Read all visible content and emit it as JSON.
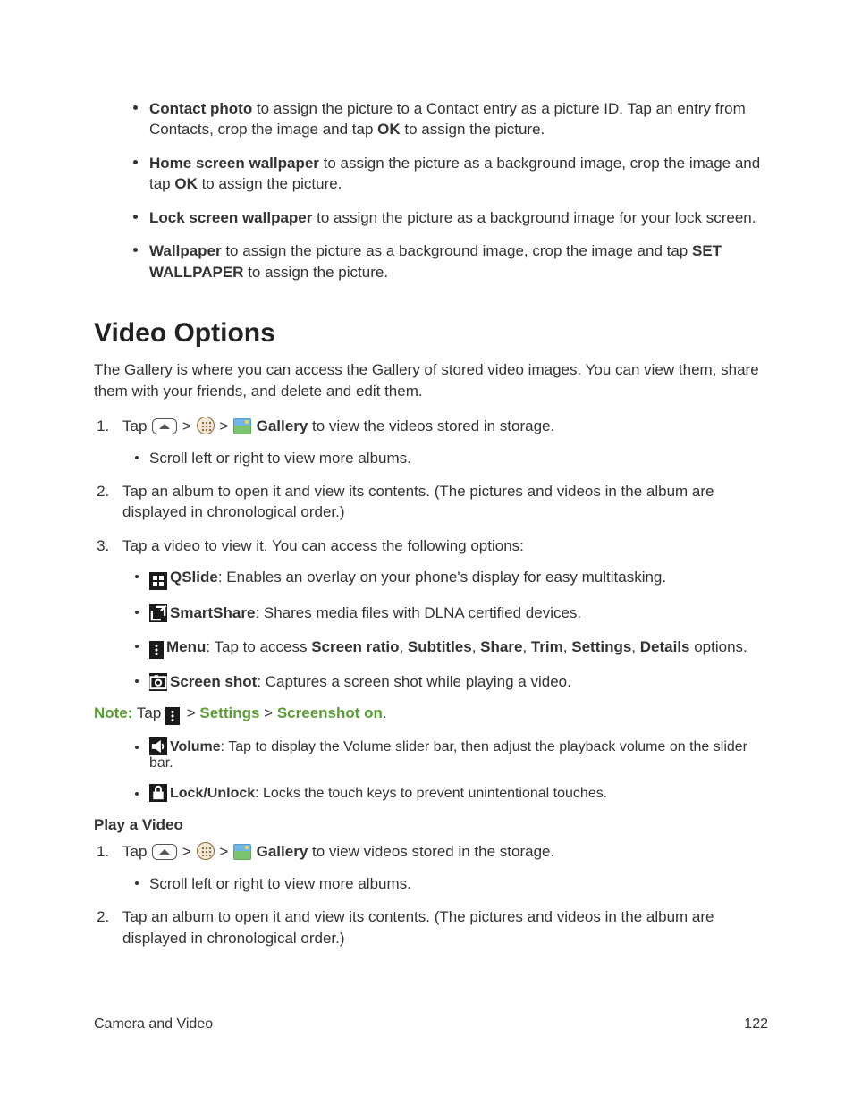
{
  "top_bullets": [
    {
      "bold": "Contact photo",
      "rest_a": " to assign the picture to a Contact entry as a picture ID. Tap an entry from Contacts, crop the image and tap ",
      "bold2": "OK",
      "rest_b": " to assign the picture."
    },
    {
      "bold": "Home screen wallpaper",
      "rest_a": " to assign the picture as a background image, crop the image and tap ",
      "bold2": "OK",
      "rest_b": " to assign the picture."
    },
    {
      "bold": "Lock screen wallpaper",
      "rest_a": " to assign the picture as a background image for your lock screen.",
      "bold2": "",
      "rest_b": ""
    },
    {
      "bold": "Wallpaper",
      "rest_a": " to assign the picture as a background image, crop the image and tap ",
      "bold2": "SET WALLPAPER",
      "rest_b": " to assign the picture."
    }
  ],
  "section_title": "Video Options",
  "intro": "The Gallery is where you can access the Gallery of stored video images. You can view them, share them with your friends, and delete and edit them.",
  "step1": {
    "tap": "Tap ",
    "gt": " > ",
    "gallery": "Gallery",
    "rest": " to view the videos stored in storage.",
    "sub": "Scroll left or right to view more albums."
  },
  "step2": "Tap an album to open it and view its contents. (The pictures and videos in the album are displayed in chronological order.)",
  "step3": {
    "lead": "Tap a video to view it. You can access the following options:",
    "items": [
      {
        "icon": "qslide",
        "name": "QSlide",
        "rest": ": Enables an overlay on your phone's display for easy multitasking."
      },
      {
        "icon": "smartshare",
        "name": "SmartShare",
        "rest": ": Shares media files with DLNA certified devices."
      },
      {
        "icon": "menu",
        "name": "Menu",
        "rest_a": ": Tap to access ",
        "opts": [
          "Screen ratio",
          "Subtitles",
          "Share",
          "Trim",
          "Settings",
          "Details"
        ],
        "rest_b": " options."
      },
      {
        "icon": "screenshot",
        "name": "Screen shot",
        "rest": ": Captures a screen shot while playing a video."
      }
    ]
  },
  "note": {
    "label": "Note:",
    "tap": " Tap ",
    "gt": " > ",
    "settings": "Settings",
    "screenshot_on": "Screenshot on",
    "dot": "."
  },
  "after_note_items": [
    {
      "icon": "volume",
      "name": "Volume",
      "rest": ": Tap to display the Volume slider bar, then adjust the playback volume on the slider bar."
    },
    {
      "icon": "lock",
      "name": "Lock/Unlock",
      "rest": ": Locks the touch keys to prevent unintentional touches."
    }
  ],
  "play_heading": "Play a Video",
  "play_step1": {
    "tap": "Tap ",
    "gt": " > ",
    "gallery": "Gallery",
    "rest": " to view videos stored in the storage.",
    "sub": "Scroll left or right to view more albums."
  },
  "play_step2": "Tap an album to open it and view its contents. (The pictures and videos in the album are displayed in chronological order.)",
  "footer": {
    "left": "Camera and Video",
    "right": "122"
  }
}
